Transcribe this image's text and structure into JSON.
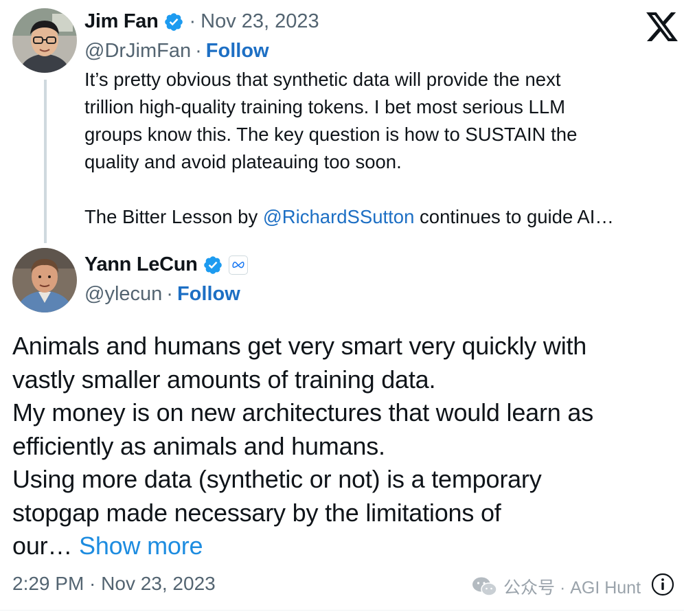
{
  "quoted_tweet": {
    "author_name": "Jim Fan",
    "date": "Nov 23, 2023",
    "handle": "@DrJimFan",
    "follow_label": "Follow",
    "text_lines": [
      "It’s pretty obvious that synthetic data will provide the next",
      "trillion high-quality training tokens. I bet most serious LLM",
      "groups know this. The key question is how to SUSTAIN the",
      "quality and avoid plateauing too soon."
    ],
    "last_line_before": "The Bitter Lesson by ",
    "last_line_mention": "@RichardSSutton",
    "last_line_after": " continues to guide AI…"
  },
  "main_tweet": {
    "author_name": "Yann LeCun",
    "handle": "@ylecun",
    "follow_label": "Follow",
    "text_lines": [
      "Animals and humans get very smart very quickly with",
      "vastly smaller amounts of training data.",
      "My money is on new architectures that would learn as",
      "efficiently as animals and humans.",
      "Using more data (synthetic or not) is a temporary",
      "stopgap made necessary by the limitations of"
    ],
    "truncated_text": "our… ",
    "show_more_label": "Show more",
    "timestamp": "2:29 PM · Nov 23, 2023"
  },
  "separator": "·",
  "watermark": {
    "text": "公众号 · AGI Hunt",
    "icon": "wechat-icon"
  },
  "icons": {
    "verified": "verified-badge-icon",
    "affiliation": "meta-affiliation-icon",
    "platform": "x-logo-icon",
    "info": "info-icon"
  },
  "colors": {
    "link": "#1d6fc4",
    "show_more": "#1d8ce0",
    "verified": "#1d9bf0",
    "secondary_text": "#536471",
    "primary_text": "#0f1419"
  }
}
